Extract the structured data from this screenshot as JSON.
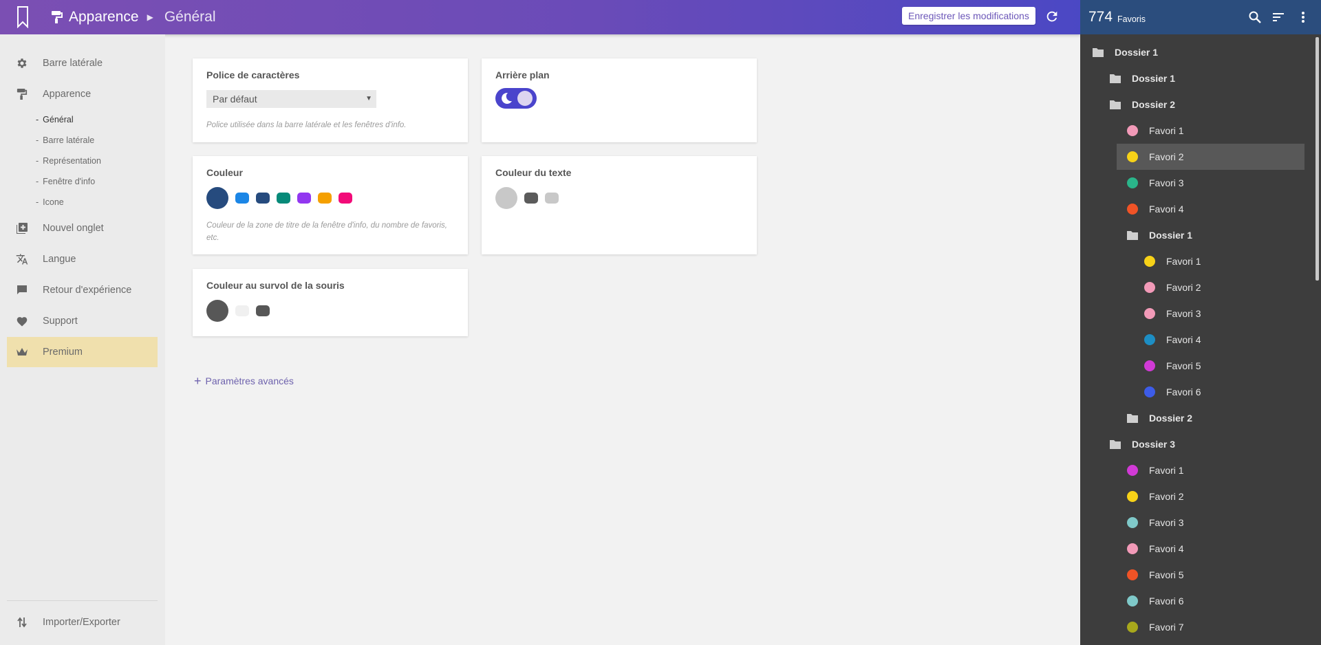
{
  "header": {
    "section": "Apparence",
    "page": "Général",
    "save_label": "Enregistrer les modifications"
  },
  "nav": {
    "items": [
      {
        "label": "Barre latérale",
        "icon": "gear-icon"
      },
      {
        "label": "Apparence",
        "icon": "paint-roller-icon"
      },
      {
        "label": "Nouvel onglet",
        "icon": "new-tab-icon"
      },
      {
        "label": "Langue",
        "icon": "translate-icon"
      },
      {
        "label": "Retour d'expérience",
        "icon": "feedback-icon"
      },
      {
        "label": "Support",
        "icon": "heart-icon"
      },
      {
        "label": "Premium",
        "icon": "crown-icon"
      }
    ],
    "subitems": [
      "Général",
      "Barre latérale",
      "Représentation",
      "Fenêtre d'info",
      "Icone"
    ],
    "dash": "-",
    "footer": {
      "label": "Importer/Exporter",
      "icon": "import-export-icon"
    }
  },
  "cards": {
    "font": {
      "title": "Police de caractères",
      "value": "Par défaut",
      "desc": "Police utilisée dans la barre latérale et les fenêtres d'info."
    },
    "background": {
      "title": "Arrière plan",
      "state": "dark"
    },
    "color": {
      "title": "Couleur",
      "desc": "Couleur de la zone de titre de la fenêtre d'info, du nombre de favoris, etc.",
      "selected": "#264b7e",
      "options": [
        "#1b86e6",
        "#264b7e",
        "#078a79",
        "#9237f0",
        "#f5a000",
        "#f20a78"
      ]
    },
    "text_color": {
      "title": "Couleur du texte",
      "selected": "#c8c8c8",
      "options": [
        "#5b5b5b",
        "#c8c8c8"
      ]
    },
    "hover_color": {
      "title": "Couleur au survol de la souris",
      "selected": "#575757",
      "options": [
        "#f0f0f0",
        "#575757"
      ]
    }
  },
  "advanced": {
    "plus": "+",
    "label": "Paramètres avancés"
  },
  "panel": {
    "count": "774",
    "count_label": "Favoris",
    "tree": [
      {
        "type": "folder",
        "label": "Dossier 1",
        "level": 0
      },
      {
        "type": "folder",
        "label": "Dossier 1",
        "level": 1
      },
      {
        "type": "folder",
        "label": "Dossier 2",
        "level": 1
      },
      {
        "type": "bookmark",
        "label": "Favori 1",
        "level": 2,
        "color": "#f29ab8"
      },
      {
        "type": "bookmark",
        "label": "Favori 2",
        "level": 2,
        "color": "#f7d218",
        "highlight": true
      },
      {
        "type": "bookmark",
        "label": "Favori 3",
        "level": 2,
        "color": "#2ab58a"
      },
      {
        "type": "bookmark",
        "label": "Favori 4",
        "level": 2,
        "color": "#f05326"
      },
      {
        "type": "folder",
        "label": "Dossier 1",
        "level": 2
      },
      {
        "type": "bookmark",
        "label": "Favori 1",
        "level": 3,
        "color": "#f7d218"
      },
      {
        "type": "bookmark",
        "label": "Favori 2",
        "level": 3,
        "color": "#f29ab8"
      },
      {
        "type": "bookmark",
        "label": "Favori 3",
        "level": 3,
        "color": "#f29ab8"
      },
      {
        "type": "bookmark",
        "label": "Favori 4",
        "level": 3,
        "color": "#1d8ec4"
      },
      {
        "type": "bookmark",
        "label": "Favori 5",
        "level": 3,
        "color": "#d13ad6"
      },
      {
        "type": "bookmark",
        "label": "Favori 6",
        "level": 3,
        "color": "#3d5ce8"
      },
      {
        "type": "folder",
        "label": "Dossier 2",
        "level": 2
      },
      {
        "type": "folder",
        "label": "Dossier 3",
        "level": 1
      },
      {
        "type": "bookmark",
        "label": "Favori 1",
        "level": 2,
        "color": "#d13ad6"
      },
      {
        "type": "bookmark",
        "label": "Favori 2",
        "level": 2,
        "color": "#f7d218"
      },
      {
        "type": "bookmark",
        "label": "Favori 3",
        "level": 2,
        "color": "#7fc9c9"
      },
      {
        "type": "bookmark",
        "label": "Favori 4",
        "level": 2,
        "color": "#f29ab8"
      },
      {
        "type": "bookmark",
        "label": "Favori 5",
        "level": 2,
        "color": "#f05326"
      },
      {
        "type": "bookmark",
        "label": "Favori 6",
        "level": 2,
        "color": "#7fc9c9"
      },
      {
        "type": "bookmark",
        "label": "Favori 7",
        "level": 2,
        "color": "#a8a81c"
      }
    ]
  },
  "colors": {
    "accent": "#6a4bb8",
    "panel_header": "#2b4d7d",
    "premium": "#f0e0ad"
  }
}
